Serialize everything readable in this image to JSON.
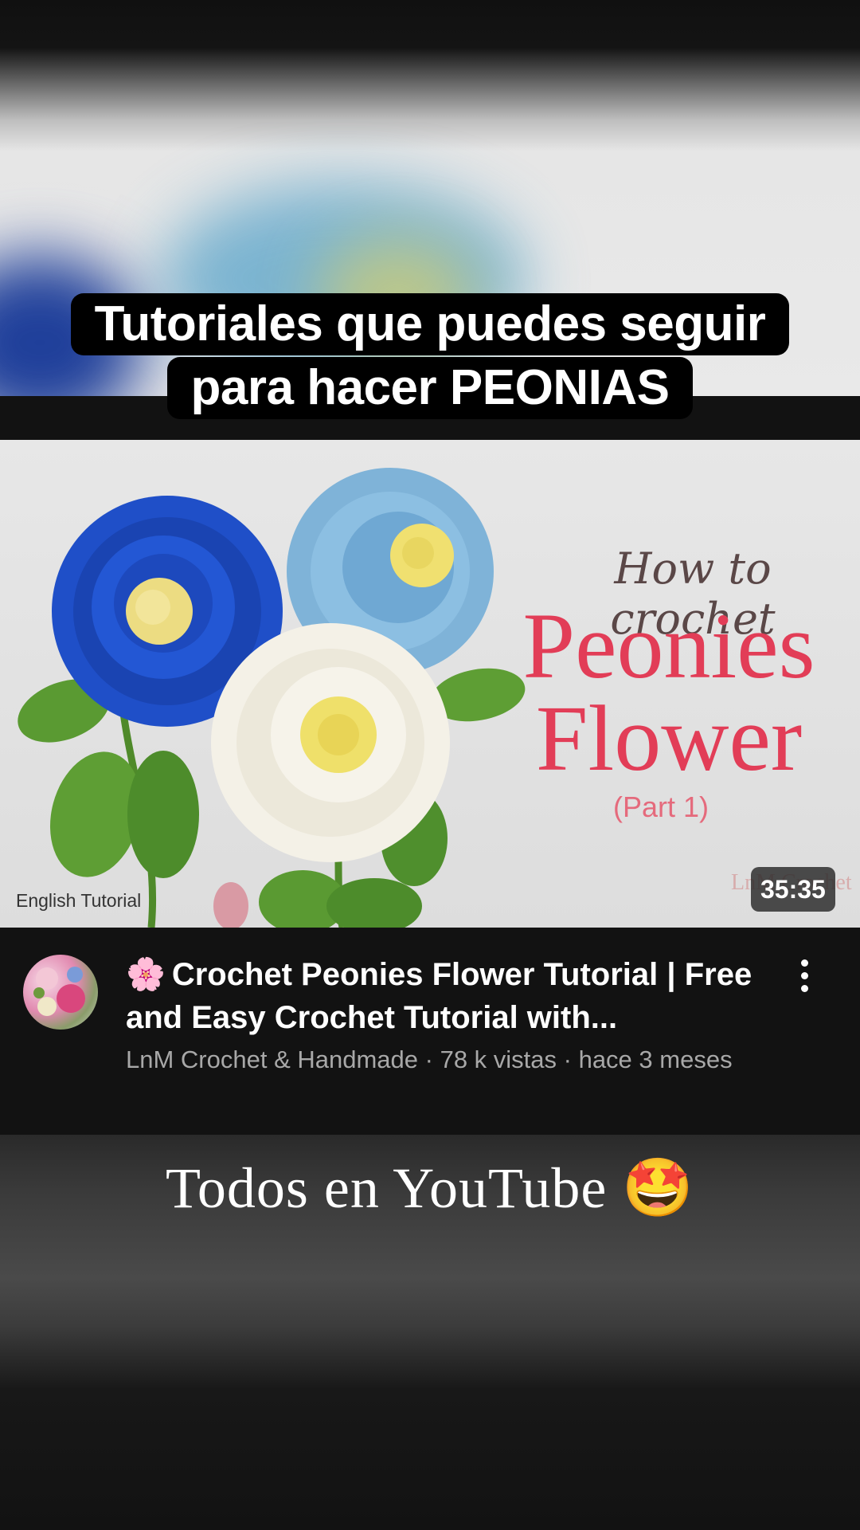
{
  "caption": {
    "line1": "Tutoriales que puedes seguir",
    "line2": "para hacer PEONIAS"
  },
  "thumbnail": {
    "heading_script": "How to crochet",
    "heading_line1": "Peonies",
    "heading_line2": "Flower",
    "part": "(Part 1)",
    "corner_label": "English Tutorial",
    "watermark": "LnM Crochet",
    "duration": "35:35"
  },
  "video": {
    "title_emoji": "🌸",
    "title": "Crochet Peonies Flower Tutorial | Free and Easy Crochet Tutorial with...",
    "channel": "LnM Crochet & Handmade",
    "stats": " · 78 k vistas · hace 3 meses"
  },
  "footer": {
    "text": "Todos en YouTube 🤩"
  },
  "icons": {
    "more": "more-vert-icon"
  }
}
